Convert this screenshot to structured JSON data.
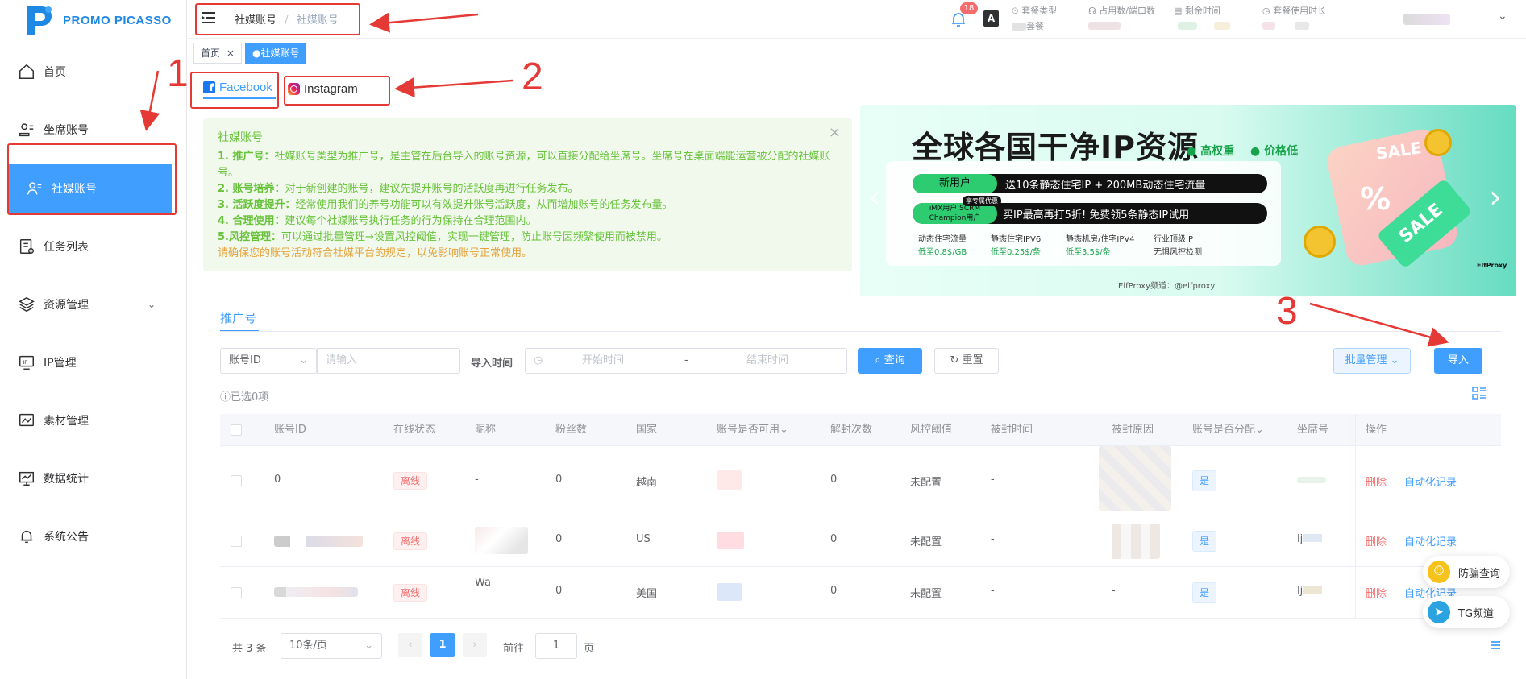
{
  "app": {
    "logo_text": "PROMO PICASSO"
  },
  "sidebar": {
    "items": [
      {
        "label": "首页",
        "icon": "home-icon"
      },
      {
        "label": "坐席账号",
        "icon": "seat-account-icon"
      },
      {
        "label": "社媒账号",
        "icon": "social-account-icon"
      },
      {
        "label": "任务列表",
        "icon": "task-list-icon"
      },
      {
        "label": "资源管理",
        "icon": "resource-icon"
      },
      {
        "label": "IP管理",
        "icon": "ip-icon"
      },
      {
        "label": "素材管理",
        "icon": "material-icon"
      },
      {
        "label": "数据统计",
        "icon": "stats-icon"
      },
      {
        "label": "系统公告",
        "icon": "bell-icon"
      }
    ]
  },
  "topbar": {
    "breadcrumb": [
      "社媒账号",
      "社媒账号"
    ],
    "breadcrumb_sep": "/",
    "notification_count": "18",
    "translate_glyph": "A",
    "stats": [
      {
        "label": "套餐类型",
        "value": "套餐"
      },
      {
        "label": "占用数/端口数",
        "value": ""
      },
      {
        "label": "剩余时间",
        "value": ""
      },
      {
        "label": "套餐使用时长",
        "value": ""
      }
    ]
  },
  "tags": [
    {
      "label": "首页",
      "close": "×"
    },
    {
      "label": "●社媒账号"
    }
  ],
  "platform_tabs": [
    {
      "label": "Facebook",
      "icon": "facebook-icon"
    },
    {
      "label": "Instagram",
      "icon": "instagram-icon"
    }
  ],
  "annotations": [
    "1",
    "2",
    "3"
  ],
  "notice": {
    "title": "社媒账号",
    "close": "×",
    "lines": [
      {
        "head": "1. 推广号：",
        "text": "社媒账号类型为推广号，是主管在后台导入的账号资源，可以直接分配给坐席号。坐席号在桌面端能运营被分配的社媒账号。"
      },
      {
        "head": "2. 账号培养：",
        "text": "对于新创建的账号，建议先提升账号的活跃度再进行任务发布。"
      },
      {
        "head": "3. 活跃度提升：",
        "text": "经常使用我们的养号功能可以有效提升账号活跃度，从而增加账号的任务发布量。"
      },
      {
        "head": "4. 合理使用：",
        "text": "建议每个社媒账号执行任务的行为保持在合理范围内。"
      },
      {
        "head": "5.风控管理：",
        "text": "可以通过批量管理→设置风控阈值，实现一键管理，防止账号因频繁使用而被禁用。"
      }
    ],
    "warning": "请确保您的账号活动符合社媒平台的规定，以免影响账号正常使用。"
  },
  "banner": {
    "title": "全球各国干净IP资源",
    "tags": [
      "高权重",
      "价格低"
    ],
    "rows": [
      {
        "badge": "新用户",
        "text": "送10条静态住宅IP + 200MB动态住宅流量"
      },
      {
        "badge": "iMX用户 SCRM Champion用户",
        "ribbon": "享专属优惠",
        "text": "买IP最高再打5折! 免费领5条静态IP试用"
      }
    ],
    "prices": [
      {
        "name": "动态住宅流量",
        "price": "低至0.8$/GB"
      },
      {
        "name": "静态住宅IPV6",
        "price": "低至0.25$/条"
      },
      {
        "name": "静态机房/住宅IPV4",
        "price": "低至3.5$/条"
      },
      {
        "name": "行业顶级IP",
        "price": "无惧风控检测"
      }
    ],
    "channel": "ElfProxy频道：@elfproxy",
    "brand": "ElfProxy",
    "sale_words": [
      "SALE",
      "SALE"
    ]
  },
  "section_tab": "推广号",
  "filters": {
    "field_select": "账号ID",
    "input_placeholder": "请输入",
    "import_time_label": "导入时间",
    "start_placeholder": "开始时间",
    "range_sep": "-",
    "end_placeholder": "结束时间",
    "search_btn": "查询",
    "reset_btn": "重置",
    "batch_btn": "批量管理",
    "import_btn": "导入"
  },
  "selected_text": "已选0项",
  "table": {
    "headers": [
      "账号ID",
      "在线状态",
      "昵称",
      "粉丝数",
      "国家",
      "账号是否可用",
      "解封次数",
      "风控阈值",
      "被封时间",
      "被封原因",
      "账号是否分配",
      "坐席号",
      "操作"
    ],
    "rows": [
      {
        "id": "0",
        "status": "离线",
        "nick": "-",
        "fans": "0",
        "country": "越南",
        "unban": "0",
        "risk": "未配置",
        "ban_time": "-",
        "ban_reason": "",
        "assigned": "是",
        "seat": "",
        "del": "删除",
        "auto": "自动化记录"
      },
      {
        "id": "",
        "status": "离线",
        "nick": "",
        "fans": "0",
        "country": "US",
        "unban": "0",
        "risk": "未配置",
        "ban_time": "-",
        "ban_reason": "",
        "assigned": "是",
        "seat": "lj",
        "del": "删除",
        "auto": "自动化记录"
      },
      {
        "id": "",
        "status": "离线",
        "nick": "Wa",
        "fans": "0",
        "country": "美国",
        "unban": "0",
        "risk": "未配置",
        "ban_time": "-",
        "ban_reason": "-",
        "assigned": "是",
        "seat": "lj",
        "del": "删除",
        "auto": "自动化记录"
      }
    ]
  },
  "pagination": {
    "total": "共 3 条",
    "page_size": "10条/页",
    "current": "1",
    "goto_label": "前往",
    "goto_value": "1",
    "page_suffix": "页"
  },
  "floating": [
    {
      "label": "防骗查询"
    },
    {
      "label": "TG频道"
    }
  ],
  "colors": {
    "primary": "#409eff",
    "annotation": "#e53935",
    "danger": "#f56c6c",
    "success": "#67c23a"
  }
}
